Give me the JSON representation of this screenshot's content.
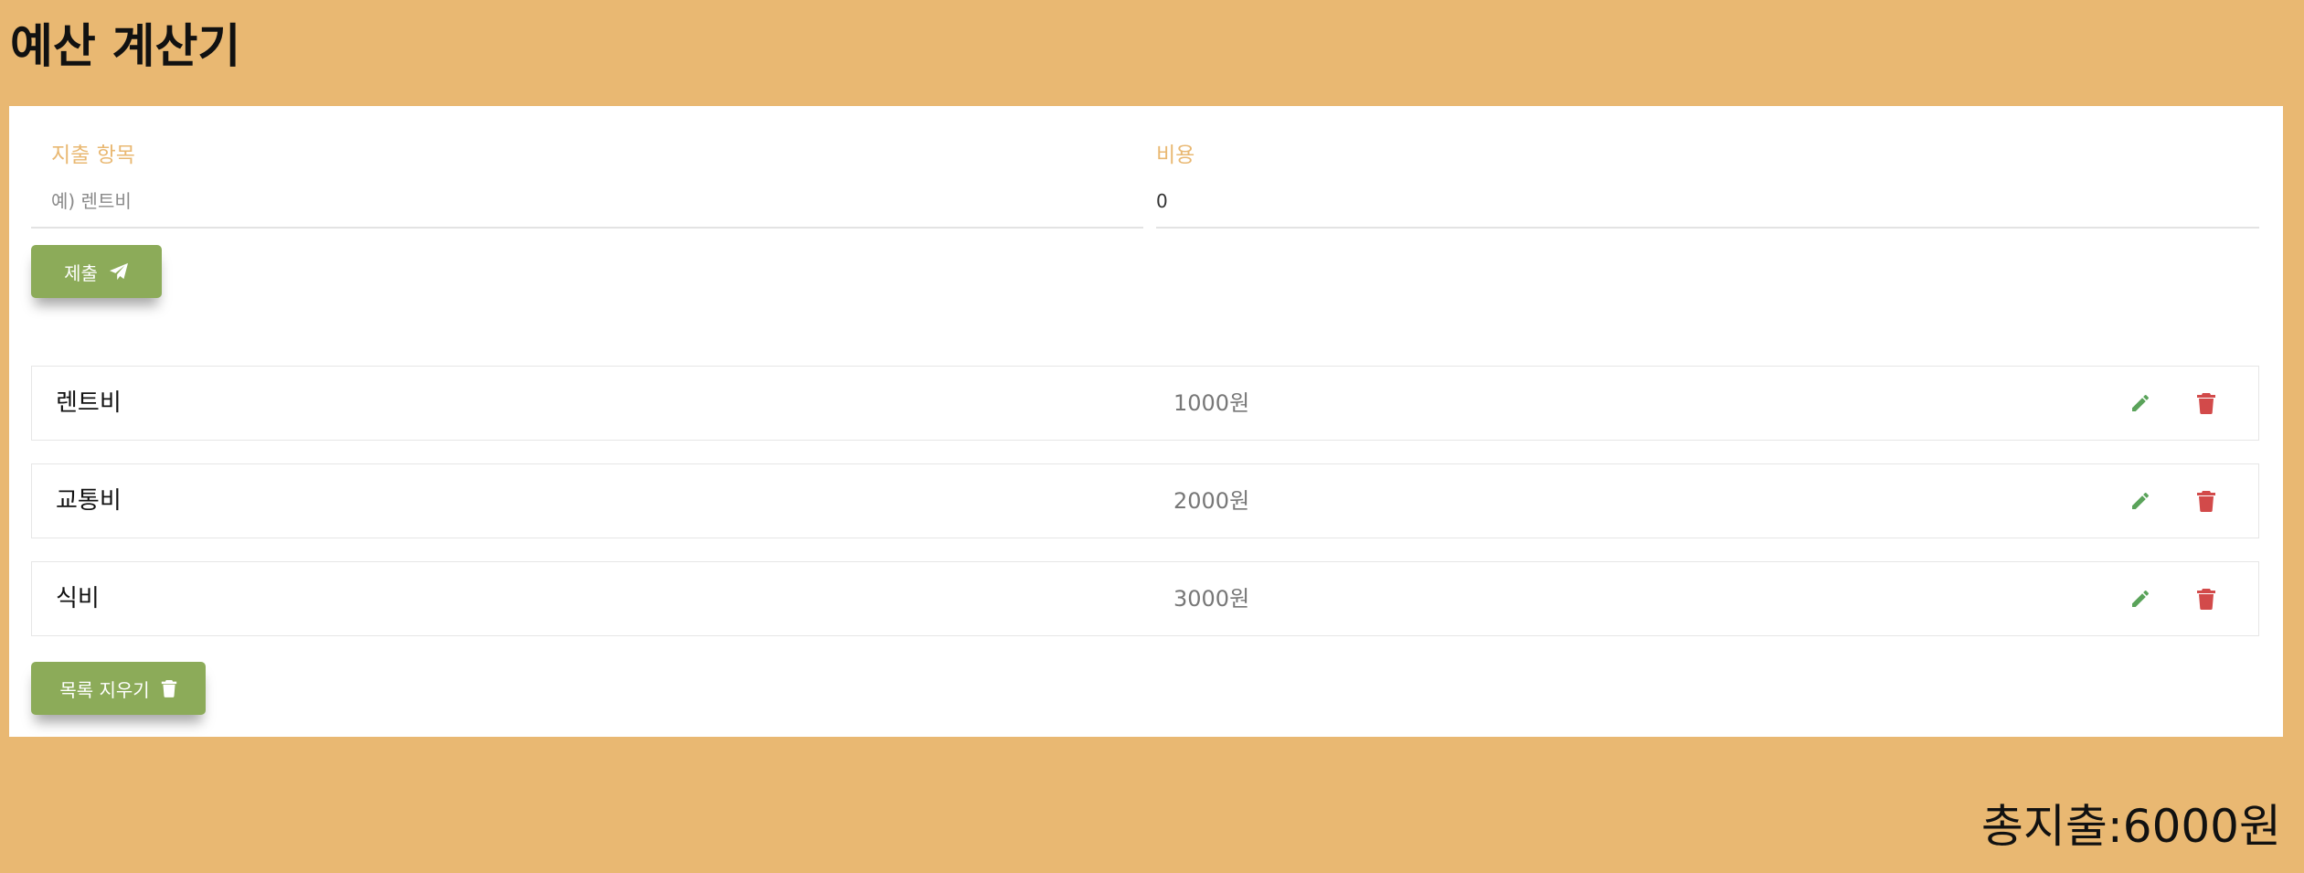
{
  "app": {
    "title": "예산 계산기"
  },
  "form": {
    "name_label": "지출 항목",
    "name_placeholder": "예) 렌트비",
    "name_value": "",
    "cost_label": "비용",
    "cost_value": "0",
    "submit_label": "제출",
    "submit_icon": "paper-plane-icon"
  },
  "expenses": [
    {
      "name": "렌트비",
      "amount": "1000원"
    },
    {
      "name": "교통비",
      "amount": "2000원"
    },
    {
      "name": "식비",
      "amount": "3000원"
    }
  ],
  "item_icons": {
    "edit": "pencil-icon",
    "delete": "trash-icon"
  },
  "clear": {
    "label": "목록 지우기",
    "icon": "trash-icon"
  },
  "total": {
    "text": "총지출:6000원"
  },
  "colors": {
    "background": "#e9b872",
    "accent_label": "#e9b872",
    "button": "#8cab59",
    "edit_icon": "#5aa35a",
    "delete_icon": "#d24a4a"
  }
}
